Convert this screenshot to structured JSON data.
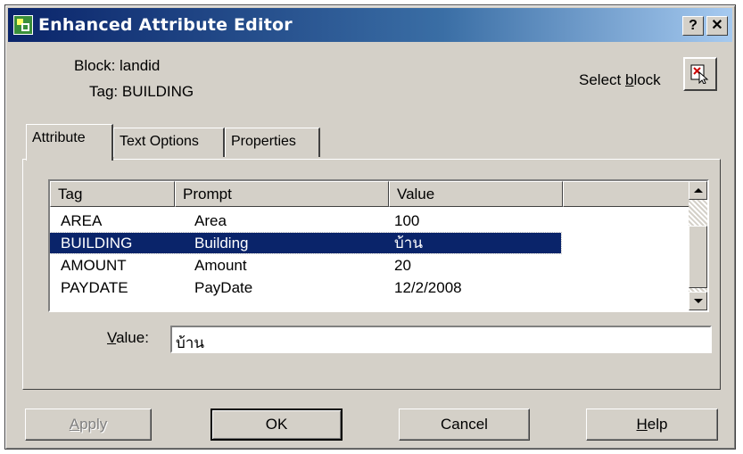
{
  "window": {
    "title": "Enhanced Attribute Editor",
    "help_glyph": "?",
    "close_glyph": "✕"
  },
  "block": {
    "block_label": "Block: landid",
    "tag_label": "Tag: BUILDING"
  },
  "select_block": {
    "label_pre": "Select ",
    "label_accel": "b",
    "label_post": "lock"
  },
  "tabs": [
    {
      "label": "Attribute",
      "active": true
    },
    {
      "label": "Text Options",
      "active": false
    },
    {
      "label": "Properties",
      "active": false
    }
  ],
  "list": {
    "columns": [
      "Tag",
      "Prompt",
      "Value"
    ],
    "rows": [
      {
        "tag": "AREA",
        "prompt": "Area",
        "value": "100",
        "selected": false
      },
      {
        "tag": "BUILDING",
        "prompt": "Building",
        "value": "บ้าน",
        "selected": true
      },
      {
        "tag": "AMOUNT",
        "prompt": "Amount",
        "value": "20",
        "selected": false
      },
      {
        "tag": "PAYDATE",
        "prompt": "PayDate",
        "value": "12/2/2008",
        "selected": false
      }
    ]
  },
  "value_field": {
    "label_accel": "V",
    "label_rest": "alue:",
    "value": "บ้าน"
  },
  "buttons": {
    "apply": {
      "accel": "A",
      "rest": "pply",
      "disabled": true
    },
    "ok": {
      "label": "OK"
    },
    "cancel": {
      "label": "Cancel"
    },
    "help": {
      "accel": "H",
      "rest": "elp"
    }
  }
}
